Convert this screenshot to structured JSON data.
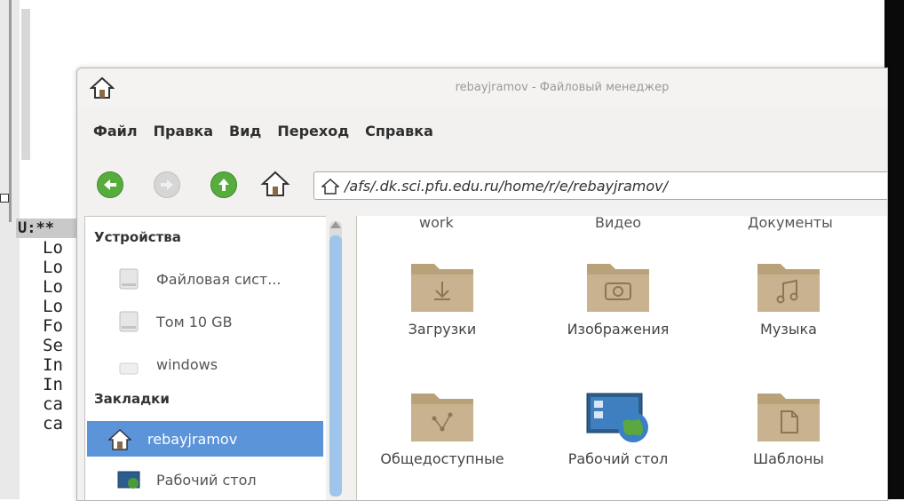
{
  "window": {
    "title": "rebayjramov - Файловый менеджер"
  },
  "menu": [
    "Файл",
    "Правка",
    "Вид",
    "Переход",
    "Справка"
  ],
  "toolbar": {
    "address": "/afs/.dk.sci.pfu.edu.ru/home/r/e/rebayjramov/"
  },
  "sidebar": {
    "devices_header": "Устройства",
    "devices": [
      {
        "label": "Файловая сист...",
        "icon": "drive-icon"
      },
      {
        "label": "Том 10 GB",
        "icon": "drive-icon"
      },
      {
        "label": "windows",
        "icon": "drive-icon"
      }
    ],
    "bookmarks_header": "Закладки",
    "bookmarks": [
      {
        "label": "rebayjramov",
        "icon": "home-icon",
        "selected": true
      },
      {
        "label": "Рабочий стол",
        "icon": "desktop-icon",
        "selected": false
      }
    ]
  },
  "content": {
    "partial_row": [
      "work",
      "Видео",
      "Документы"
    ],
    "items": [
      {
        "label": "Загрузки",
        "icon": "download-folder-icon"
      },
      {
        "label": "Изображения",
        "icon": "camera-folder-icon"
      },
      {
        "label": "Музыка",
        "icon": "music-folder-icon"
      },
      {
        "label": "Общедоступные",
        "icon": "share-folder-icon"
      },
      {
        "label": "Рабочий стол",
        "icon": "desktop-globe-icon"
      },
      {
        "label": "Шаблоны",
        "icon": "template-folder-icon"
      }
    ]
  },
  "terminal": {
    "status": "U:**",
    "lines": [
      "Lo",
      "Lo",
      "Lo",
      "Lo",
      "Fo",
      "Se",
      "In",
      "In",
      "ca",
      "ca"
    ]
  },
  "colors": {
    "selection": "#5b94d9",
    "folder": "#c8b28f",
    "nav_green": "#56ad3c"
  }
}
